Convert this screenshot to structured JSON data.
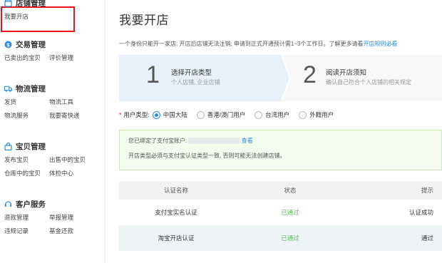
{
  "sidebar": {
    "shop": {
      "title": "店铺管理",
      "items": [
        "我要开店"
      ]
    },
    "trade": {
      "title": "交易管理",
      "items": [
        "已卖出的宝贝",
        "评价管理"
      ]
    },
    "logistics": {
      "title": "物流管理",
      "items": [
        "发货",
        "物流工具",
        "物流服务",
        "我要寄快递"
      ]
    },
    "goods": {
      "title": "宝贝管理",
      "items": [
        "发布宝贝",
        "出售中的宝贝",
        "仓库中的宝贝",
        "体检中心"
      ]
    },
    "service": {
      "title": "客户服务",
      "items": [
        "退款管理",
        "举报管理",
        "违规记录",
        "基金还款"
      ]
    }
  },
  "main": {
    "title": "我要开店",
    "notice": "一个身份只能开一家店; 开店后店铺无法注销; 申请到正式开通预计需1~3个工作日。了解更多请看",
    "notice_link": "开店规则必看",
    "steps": [
      {
        "num": "1",
        "title": "选择开店类型",
        "sub": "个人店铺, 企业店铺"
      },
      {
        "num": "2",
        "title": "阅读开店须知",
        "sub": "确认自己符合个人店铺的相关规定"
      }
    ],
    "user_type": {
      "required_mark": "*",
      "label": "用户类型:",
      "options": [
        "中国大陆",
        "香港/澳门用户",
        "台湾用户",
        "外籍用户"
      ],
      "selected": 0
    },
    "alipay": {
      "line1": "您已绑定了支付宝账户:",
      "link": "查看",
      "line2": "开店类型必须与支付宝认证类型一致, 否则可能无法创建店铺。"
    },
    "table": {
      "headers": [
        "认证名称",
        "状态",
        "提示"
      ],
      "rows": [
        [
          "支付宝实名认证",
          "已通过",
          "认证成功"
        ],
        [
          "淘宝开店认证",
          "已通过",
          "通过"
        ]
      ]
    }
  },
  "colors": {
    "accent": "#2b8ce0",
    "highlight_border": "#e8131c",
    "success": "#5cb85c"
  }
}
